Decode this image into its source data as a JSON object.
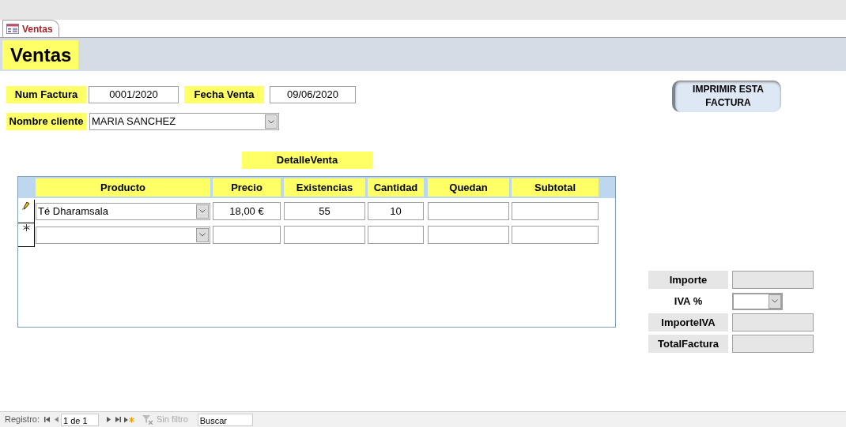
{
  "tab": {
    "label": "Ventas",
    "selected": true
  },
  "title": "Ventas",
  "fields": [
    {
      "label": "Num Factura",
      "value": "0001/2020"
    },
    {
      "label": "Fecha Venta",
      "value": "09/06/2020"
    }
  ],
  "cliente": {
    "label": "Nombre cliente",
    "value": "MARIA SANCHEZ"
  },
  "print_button": "IMPRIMIR ESTA FACTURA",
  "subform": {
    "title": "DetalleVenta",
    "columns": [
      "Producto",
      "Precio",
      "Existencias",
      "Cantidad",
      "Quedan",
      "Subtotal"
    ],
    "rows": [
      {
        "kind": "editing",
        "cells": [
          "Té Dharamsala",
          "18,00 €",
          "55",
          "10",
          "",
          ""
        ]
      },
      {
        "kind": "new",
        "cells": [
          "",
          "",
          "",
          "",
          "",
          ""
        ]
      }
    ]
  },
  "totals": [
    {
      "label": "Importe",
      "kind": "text"
    },
    {
      "label": "IVA %",
      "kind": "combo"
    },
    {
      "label": "ImporteIVA",
      "kind": "text"
    },
    {
      "label": "TotalFactura",
      "kind": "text"
    }
  ],
  "status_bar": {
    "label": "Registro:",
    "record": "1 de 1",
    "filter": "Sin filtro",
    "search": "Buscar"
  }
}
